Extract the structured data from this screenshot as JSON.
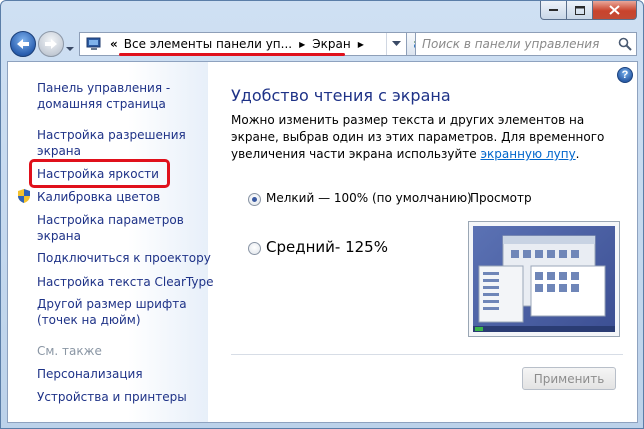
{
  "window": {
    "accent": "#bcd2ea",
    "highlight_color": "#e0101b"
  },
  "addressbar": {
    "prefix": "«",
    "segments": [
      "Все элементы панели уп...",
      "Экран"
    ]
  },
  "search": {
    "placeholder": "Поиск в панели управления"
  },
  "sidebar": {
    "items": [
      {
        "label": "Панель управления -\nдомашняя страница"
      },
      {
        "label": "Настройка разрешения\nэкрана"
      },
      {
        "label": "Настройка яркости"
      },
      {
        "label": "Калибровка цветов",
        "icon": "shield-icon"
      },
      {
        "label": "Настройка параметров\nэкрана"
      },
      {
        "label": "Подключиться к проектору"
      },
      {
        "label": "Настройка текста ClearType"
      },
      {
        "label": "Другой размер шрифта\n(точек на дюйм)"
      }
    ],
    "see_also": "См. также",
    "see_also_items": [
      {
        "label": "Персонализация"
      },
      {
        "label": "Устройства и принтеры"
      }
    ]
  },
  "main": {
    "title": "Удобство чтения с экрана",
    "desc_before": "Можно изменить размер текста и других элементов на экране, выбрав один из этих параметров. Для временного увеличения части экрана используйте ",
    "desc_link": "экранную лупу",
    "desc_after": ".",
    "options": [
      {
        "label": "Мелкий — 100% (по умолчанию)",
        "checked": true
      },
      {
        "label": "Средний- 125%",
        "checked": false
      }
    ],
    "preview_label": "Просмотр",
    "apply_label": "Применить",
    "help_label": "?"
  }
}
